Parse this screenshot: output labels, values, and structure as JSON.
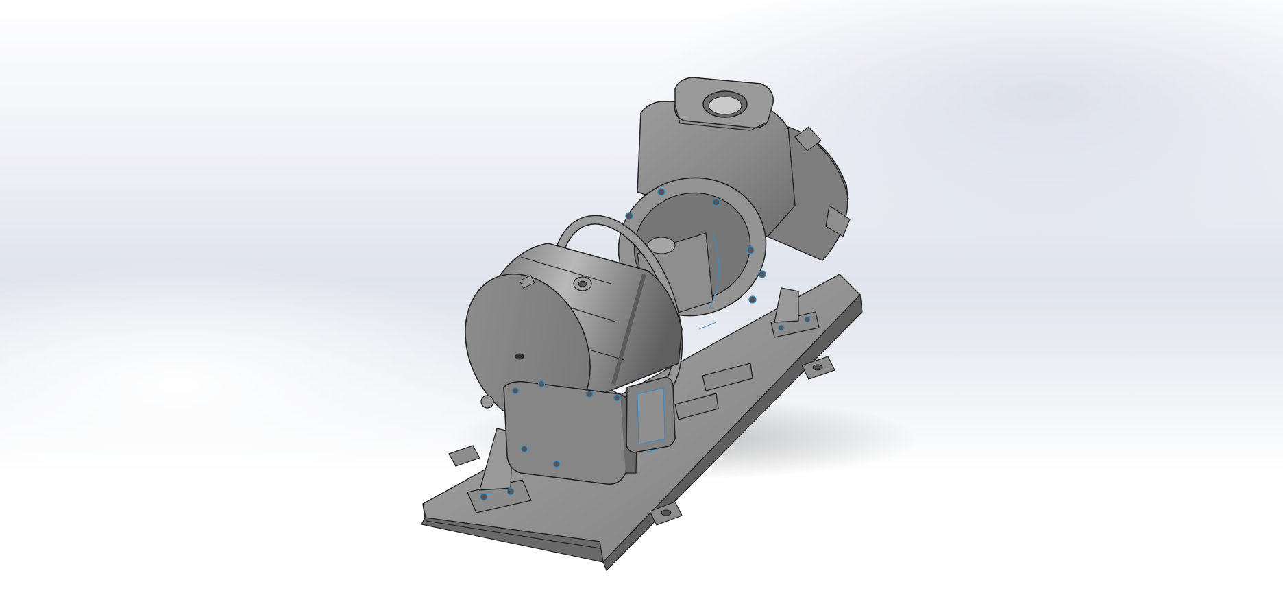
{
  "viewport": {
    "type": "cad-graphics-area",
    "background": {
      "top": "#ffffff",
      "middle": "#dfe3ec",
      "bottom": "#ffffff"
    },
    "model": {
      "name": "pump-motor-assembly-on-baseplate",
      "shading": "shaded-with-edges",
      "base_color": "#8a8a8a",
      "edge_color": "#1e1e1e",
      "highlight_edge_color": "#2f8fd0"
    }
  }
}
